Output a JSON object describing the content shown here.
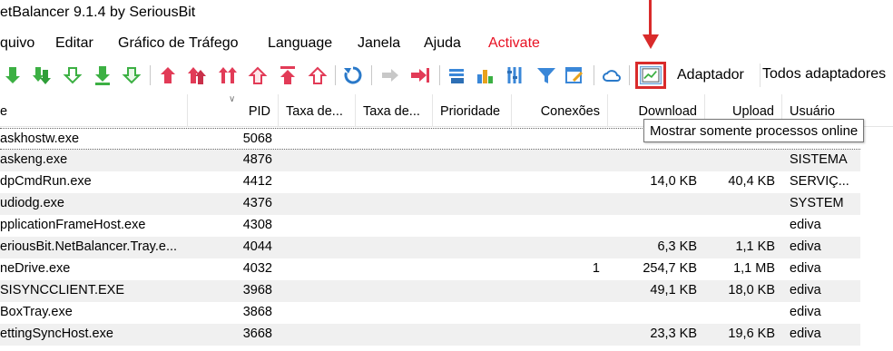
{
  "window": {
    "title": "etBalancer 9.1.4 by SeriousBit"
  },
  "menu": {
    "items": [
      "quivo",
      "Editar",
      "Gráfico de Tráfego",
      "Language",
      "Janela",
      "Ajuda"
    ],
    "activate": "Activate",
    "activate_color": "#e81123"
  },
  "toolbar": {
    "icons": [
      "down-priority-icon",
      "down-priority-double-icon",
      "down-priority-light-icon",
      "down-bar-icon",
      "down-outline-icon",
      "up-priority-icon",
      "up-priority-double-icon",
      "up-priority-triple-icon",
      "up-outline-icon",
      "up-bar-icon",
      "up-light-icon",
      "refresh-icon",
      "forward-icon",
      "block-icon",
      "adapter-icon",
      "chart-bars-icon",
      "tools-icon",
      "filter-icon",
      "rules-icon",
      "cloud-icon",
      "online-processes-icon"
    ],
    "adapter_label": "Adaptador",
    "adapter_value": "Todos adaptadores",
    "highlight_color": "#d92b2b"
  },
  "table": {
    "columns": [
      "e",
      "PID",
      "Taxa de...",
      "Taxa de...",
      "Prioridade",
      "Conexões",
      "Download",
      "Upload",
      "Usuário"
    ],
    "rows": [
      {
        "name": "askhostw.exe",
        "pid": "5068",
        "conn": "",
        "down": "",
        "up": "",
        "user": ""
      },
      {
        "name": "askeng.exe",
        "pid": "4876",
        "conn": "",
        "down": "",
        "up": "",
        "user": "SISTEMA"
      },
      {
        "name": "dpCmdRun.exe",
        "pid": "4412",
        "conn": "",
        "down": "14,0 KB",
        "up": "40,4 KB",
        "user": "SERVIÇ..."
      },
      {
        "name": "udiodg.exe",
        "pid": "4376",
        "conn": "",
        "down": "",
        "up": "",
        "user": "SYSTEM"
      },
      {
        "name": "pplicationFrameHost.exe",
        "pid": "4308",
        "conn": "",
        "down": "",
        "up": "",
        "user": "ediva"
      },
      {
        "name": "eriousBit.NetBalancer.Tray.e...",
        "pid": "4044",
        "conn": "",
        "down": "6,3 KB",
        "up": "1,1 KB",
        "user": "ediva"
      },
      {
        "name": "neDrive.exe",
        "pid": "4032",
        "conn": "1",
        "down": "254,7 KB",
        "up": "1,1 MB",
        "user": "ediva"
      },
      {
        "name": "SISYNCCLIENT.EXE",
        "pid": "3968",
        "conn": "",
        "down": "49,1 KB",
        "up": "18,0 KB",
        "user": "ediva"
      },
      {
        "name": "BoxTray.exe",
        "pid": "3868",
        "conn": "",
        "down": "",
        "up": "",
        "user": "ediva"
      },
      {
        "name": "ettingSyncHost.exe",
        "pid": "3668",
        "conn": "",
        "down": "23,3 KB",
        "up": "19,6 KB",
        "user": "ediva"
      }
    ]
  },
  "tooltip": {
    "text": "Mostrar somente processos online"
  }
}
